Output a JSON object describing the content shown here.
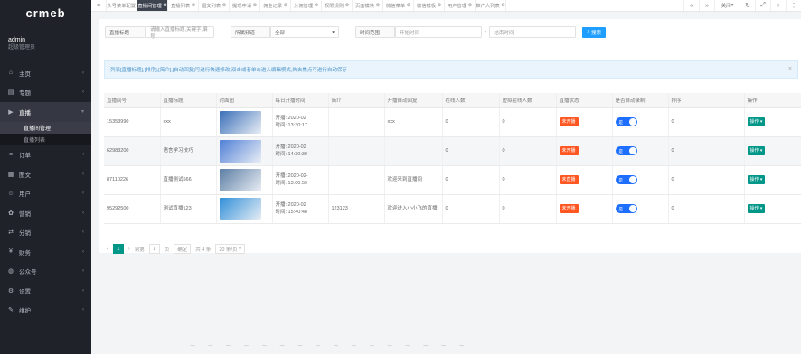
{
  "brand": {
    "logo": "crmeb"
  },
  "user": {
    "name": "admin",
    "role": "超级管理员"
  },
  "sidebar": {
    "items": [
      {
        "label": "主页",
        "icon": "home-icon",
        "glyph": "⌂"
      },
      {
        "label": "专题",
        "icon": "book-icon",
        "glyph": "▤"
      },
      {
        "label": "直播",
        "icon": "video-icon",
        "glyph": "▶"
      },
      {
        "label": "订单",
        "icon": "list-icon",
        "glyph": "≡"
      },
      {
        "label": "图文",
        "icon": "doc-icon",
        "glyph": "▦"
      },
      {
        "label": "用户",
        "icon": "user-icon",
        "glyph": "☺"
      },
      {
        "label": "营销",
        "icon": "gift-icon",
        "glyph": "✿"
      },
      {
        "label": "分销",
        "icon": "share-icon",
        "glyph": "⇄"
      },
      {
        "label": "财务",
        "icon": "wallet-icon",
        "glyph": "¥"
      },
      {
        "label": "公众号",
        "icon": "wechat-icon",
        "glyph": "◍"
      },
      {
        "label": "设置",
        "icon": "gear-icon",
        "glyph": "⚙"
      },
      {
        "label": "维护",
        "icon": "wrench-icon",
        "glyph": "✎"
      }
    ],
    "sub": [
      "直播间管理",
      "直播列表"
    ]
  },
  "topbar": {
    "tabs": [
      "公众号菜单配置",
      "直播间管理",
      "直播列表",
      "图文列表",
      "提现申请",
      "佣金记录",
      "分佣管理",
      "权限规则",
      "页面模块",
      "微信菜单",
      "微信模板",
      "用户管理",
      "推广人列表"
    ],
    "close_label": "关闭"
  },
  "filters": {
    "title_label": "直播标题",
    "title_placeholder": "请输入直播标题,关键字,编号",
    "status_label": "所属频道",
    "status_value": "全部",
    "time_label": "时间范围",
    "start_placeholder": "开始时间",
    "end_placeholder": "结束时间",
    "sep": "-",
    "search_label": "搜索"
  },
  "notice": {
    "text": "列表[直播标题],[排序],[简介],[自动回复]可进行快速修改,双击或者单击进入编辑模式,失去焦点可进行自动保存"
  },
  "table": {
    "columns": [
      "直播间号",
      "直播标题",
      "封面图",
      "每日开播时间",
      "简介",
      "开播自动回复",
      "在线人数",
      "虚拟在线人数",
      "直播状态",
      "是否自动录制",
      "排序",
      "操作"
    ],
    "rows": [
      {
        "id": "15353990",
        "title": "xxx",
        "cover": "#3a6fb8",
        "time1": "开播: 2020-02",
        "time2": "时间: 13:30:17",
        "intro": "",
        "reply": "xxx",
        "online": "0",
        "virtual": "0",
        "status": "未开播",
        "switch": "是",
        "sort": "0",
        "op": "操作"
      },
      {
        "id": "62983200",
        "title": "语言学习技巧",
        "cover": "#4f7fd6",
        "time1": "开播: 2020-02",
        "time2": "时间: 14:30:30",
        "intro": "",
        "reply": "",
        "online": "0",
        "virtual": "0",
        "status": "未开播",
        "switch": "是",
        "sort": "0",
        "op": "操作"
      },
      {
        "id": "87110226",
        "title": "直播测试666",
        "cover": "#5b7da3",
        "time1": "开播: 2020-02-",
        "time2": "时间: 13:00:59",
        "intro": "",
        "reply": "欢迎来到直播间",
        "online": "0",
        "virtual": "0",
        "status": "未直播",
        "switch": "是",
        "sort": "0",
        "op": "操作"
      },
      {
        "id": "95292500",
        "title": "测试直播123",
        "cover": "#2f8fd8",
        "time1": "开播: 2020-02",
        "time2": "时间: 15:40:48",
        "intro": "123123",
        "reply": "欢迎进入小小飞的直播",
        "online": "0",
        "virtual": "0",
        "status": "未开播",
        "switch": "是",
        "sort": "0",
        "op": "操作"
      }
    ]
  },
  "pager": {
    "prev": "‹",
    "current": "1",
    "next": "›",
    "goto": "到第",
    "page_input": "1",
    "page_unit": "页",
    "confirm": "确定",
    "total": "共 4 条",
    "per_page": "20 条/页"
  },
  "colors": {
    "sidebar": "#20222a",
    "accent": "#009688",
    "status": "#ff5722",
    "switch": "#1e6fff",
    "search": "#1e9fff"
  }
}
